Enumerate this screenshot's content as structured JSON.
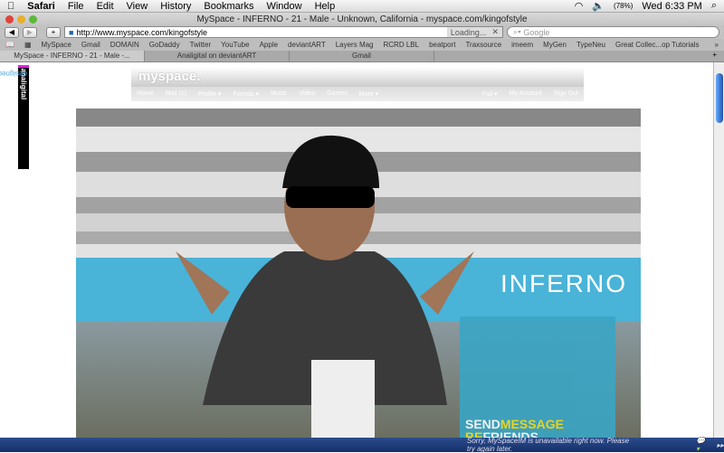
{
  "menubar": {
    "app": "Safari",
    "items": [
      "File",
      "Edit",
      "View",
      "History",
      "Bookmarks",
      "Window",
      "Help"
    ],
    "battery": "(78%)",
    "clock": "Wed 6:33 PM"
  },
  "window": {
    "title": "MySpace - INFERNO - 21 - Male - Unknown, California - myspace.com/kingofstyle"
  },
  "toolbar": {
    "url": "http://www.myspace.com/kingofstyle",
    "loading": "Loading...",
    "search_placeholder": "Google"
  },
  "bookmarks": [
    "MySpace",
    "Gmail",
    "DOMAIN",
    "GoDaddy",
    "Twitter",
    "YouTube",
    "Apple",
    "deviantART",
    "Layers Mag",
    "RCRD LBL",
    "beatport",
    "Traxsource",
    "imeem",
    "MyGen",
    "TypeNeu",
    "Great Collec...op Tutorials"
  ],
  "tabs": [
    "MySpace - INFERNO - 21 - Male -...",
    "Analigital on deviantART",
    "Gmail"
  ],
  "badge": {
    "line1": "designed by:",
    "line2": "analigital"
  },
  "myspace": {
    "logo": "myspace.",
    "nav": [
      "Home",
      "Mail (1)",
      "Profile ▾",
      "Friends ▾",
      "Music",
      "Video",
      "Games",
      "More ▾"
    ],
    "nav_right": [
      "Full ▾",
      "My Account",
      "Sign Out"
    ]
  },
  "hero": {
    "name": "INFERNO",
    "cta1a": "SEND",
    "cta1b": "MESSAGE",
    "cta2a": "BE",
    "cta2b": "FRIENDS"
  },
  "im": {
    "status": "Sorry, MySpaceIM is unavailable right now. Please try again later."
  }
}
